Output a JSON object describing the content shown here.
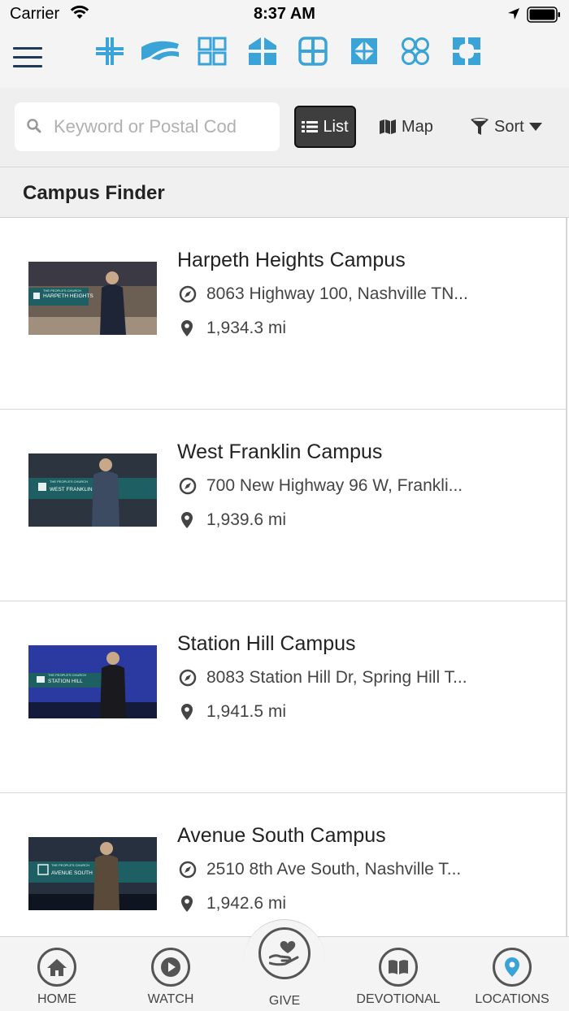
{
  "status_bar": {
    "carrier": "Carrier",
    "time": "8:37 AM"
  },
  "header": {
    "campus_icons": [
      "campus-logo-cross",
      "campus-logo-wing",
      "campus-logo-grid",
      "campus-logo-window",
      "campus-logo-frame",
      "campus-logo-diamond",
      "campus-logo-circles",
      "campus-logo-petals"
    ],
    "accent_color": "#3aa3d8"
  },
  "search": {
    "placeholder": "Keyword or Postal Cod",
    "value": ""
  },
  "view_toggle": {
    "list_label": "List",
    "map_label": "Map",
    "sort_label": "Sort"
  },
  "section": {
    "title": "Campus Finder"
  },
  "campuses": [
    {
      "name": "Harpeth Heights Campus",
      "address": "8063 Highway 100, Nashville TN...",
      "distance": "1,934.3 mi",
      "thumb_label_small": "THE PEOPLE'S CHURCH",
      "thumb_label_big": "HARPETH HEIGHTS",
      "thumb_bg": "#6a5a4c"
    },
    {
      "name": "West Franklin Campus",
      "address": "700 New Highway 96 W, Frankli...",
      "distance": "1,939.6 mi",
      "thumb_label_small": "THE PEOPLE'S CHURCH",
      "thumb_label_big": "WEST FRANKLIN",
      "thumb_bg": "#2c3440"
    },
    {
      "name": "Station Hill Campus",
      "address": "8083 Station Hill Dr, Spring Hill T...",
      "distance": "1,941.5 mi",
      "thumb_label_small": "THE PEOPLE'S CHURCH",
      "thumb_label_big": "STATION HILL",
      "thumb_bg": "#2a3aa0"
    },
    {
      "name": "Avenue South Campus",
      "address": "2510 8th Ave South, Nashville T...",
      "distance": "1,942.6 mi",
      "thumb_label_small": "THE PEOPLE'S CHURCH",
      "thumb_label_big": "AVENUE SOUTH",
      "thumb_bg": "#26303e"
    }
  ],
  "tabs": [
    {
      "label": "HOME",
      "icon": "home-icon"
    },
    {
      "label": "WATCH",
      "icon": "play-icon"
    },
    {
      "label": "GIVE",
      "icon": "heart-hand-icon"
    },
    {
      "label": "DEVOTIONAL",
      "icon": "book-icon"
    },
    {
      "label": "LOCATIONS",
      "icon": "map-pin-icon"
    }
  ]
}
